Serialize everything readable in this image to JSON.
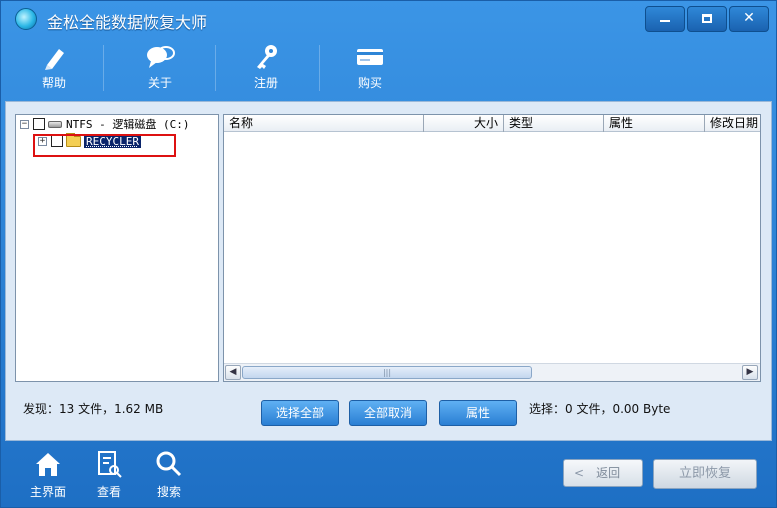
{
  "window": {
    "title": "金松全能数据恢复大师",
    "controls": {
      "minimize": "minimize",
      "maximize": "maximize",
      "close": "✕"
    }
  },
  "toolbar": {
    "items": [
      {
        "label": "帮助",
        "icon": "pen-icon"
      },
      {
        "label": "关于",
        "icon": "chat-bubbles-icon"
      },
      {
        "label": "注册",
        "icon": "key-icon"
      },
      {
        "label": "购买",
        "icon": "card-icon"
      }
    ]
  },
  "tree": {
    "root": {
      "label": "NTFS - 逻辑磁盘 (C:)",
      "expander": "−"
    },
    "child": {
      "label": "RECYCLER",
      "expander": "+"
    }
  },
  "list": {
    "columns": [
      "名称",
      "大小",
      "类型",
      "属性",
      "修改日期"
    ],
    "rows": []
  },
  "status": {
    "found": "发现：13 文件，1.62 MB",
    "selected": "选择：0 文件，0.00 Byte"
  },
  "actions": {
    "select_all": "选择全部",
    "deselect_all": "全部取消",
    "properties": "属性"
  },
  "bottom_nav": [
    {
      "label": "主界面",
      "icon": "home-icon"
    },
    {
      "label": "查看",
      "icon": "document-search-icon"
    },
    {
      "label": "搜索",
      "icon": "magnifier-icon"
    }
  ],
  "bottom_actions": {
    "back": "返回",
    "recover_now": "立即恢复"
  }
}
